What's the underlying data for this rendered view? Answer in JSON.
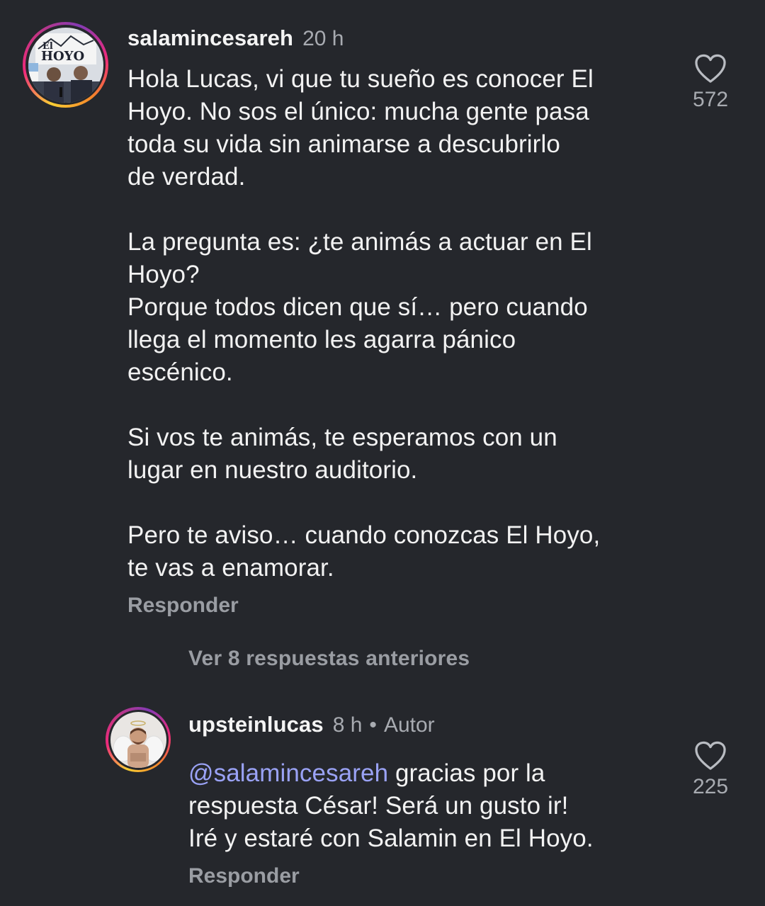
{
  "comment": {
    "username": "salamincesareh",
    "time": "20 h",
    "avatar_text": "El HOYO",
    "paragraphs": [
      "Hola Lucas, vi que tu sueño es conocer El\nHoyo. No sos el único: mucha gente pasa\ntoda su vida sin animarse a descubrirlo\nde verdad.",
      "La pregunta es: ¿te animás a actuar en El\nHoyo?\nPorque todos dicen que sí… pero cuando\nllega el momento les agarra pánico\nescénico.",
      "Si vos te animás, te esperamos con un\nlugar en nuestro auditorio.",
      "Pero te aviso… cuando conozcas El Hoyo,\nte vas a enamorar."
    ],
    "reply_label": "Responder",
    "like_count": "572"
  },
  "view_more_label": "Ver 8 respuestas anteriores",
  "reply": {
    "username": "upsteinlucas",
    "time": "8 h",
    "separator": "•",
    "author_label": "Autor",
    "mention": "@salamincesareh",
    "text_line1": " gracias por la",
    "text_rest": "respuesta César! Será un gusto ir!\nIré y estaré con Salamin en El Hoyo.",
    "reply_label": "Responder",
    "like_count": "225"
  },
  "colors": {
    "background": "#25272c",
    "mention": "#9aa2f5",
    "secondary_text": "#a8abb1"
  }
}
